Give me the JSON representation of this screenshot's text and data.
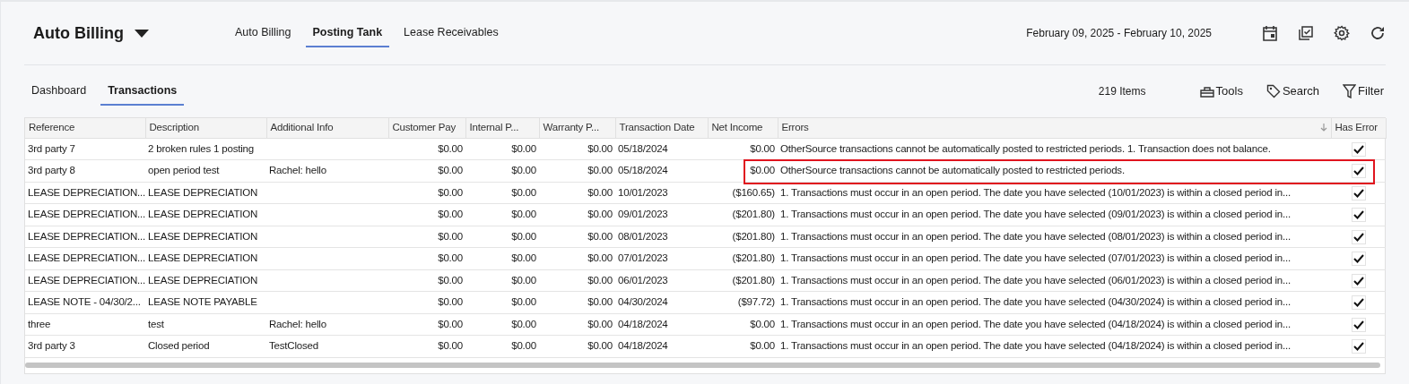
{
  "header": {
    "title": "Auto Billing",
    "nav_tabs": [
      {
        "label": "Auto Billing",
        "selected": false
      },
      {
        "label": "Posting Tank",
        "selected": true
      },
      {
        "label": "Lease Receivables",
        "selected": false
      }
    ],
    "date_range": "February 09, 2025 - February 10, 2025"
  },
  "sub_tabs": [
    {
      "label": "Dashboard",
      "selected": false
    },
    {
      "label": "Transactions",
      "selected": true
    }
  ],
  "toolbar": {
    "item_count": "219 Items",
    "actions": [
      {
        "kind": "tools",
        "label": "Tools"
      },
      {
        "kind": "search",
        "label": "Search"
      },
      {
        "kind": "filter",
        "label": "Filter"
      }
    ]
  },
  "table": {
    "columns": [
      {
        "label": "Reference",
        "sorted": false
      },
      {
        "label": "Description",
        "sorted": false
      },
      {
        "label": "Additional Info",
        "sorted": false
      },
      {
        "label": "Customer Pay",
        "sorted": false
      },
      {
        "label": "Internal P...",
        "sorted": false
      },
      {
        "label": "Warranty P...",
        "sorted": false
      },
      {
        "label": "Transaction Date",
        "sorted": false
      },
      {
        "label": "Net Income",
        "sorted": false
      },
      {
        "label": "Errors",
        "sorted": true
      },
      {
        "label": "Has Error",
        "sorted": false
      }
    ],
    "rows": [
      {
        "cells": [
          "3rd party 7",
          "2 broken rules 1 posting",
          "",
          "$0.00",
          "$0.00",
          "$0.00",
          "05/18/2024",
          "$0.00",
          "OtherSource transactions cannot be automatically posted to restricted periods. 1. Transaction does not balance."
        ],
        "has_error": true,
        "highlighted": false
      },
      {
        "cells": [
          "3rd party 8",
          "open period test",
          "Rachel: hello",
          "$0.00",
          "$0.00",
          "$0.00",
          "05/18/2024",
          "$0.00",
          "OtherSource transactions cannot be automatically posted to restricted periods."
        ],
        "has_error": true,
        "highlighted": true
      },
      {
        "cells": [
          "LEASE DEPRECIATION...",
          "LEASE DEPRECIATION",
          "",
          "$0.00",
          "$0.00",
          "$0.00",
          "10/01/2023",
          "($160.65)",
          "1. Transactions must occur in an open period. The date you have selected (10/01/2023) is within a closed period in..."
        ],
        "has_error": true,
        "highlighted": false
      },
      {
        "cells": [
          "LEASE DEPRECIATION...",
          "LEASE DEPRECIATION",
          "",
          "$0.00",
          "$0.00",
          "$0.00",
          "09/01/2023",
          "($201.80)",
          "1. Transactions must occur in an open period. The date you have selected (09/01/2023) is within a closed period in..."
        ],
        "has_error": true,
        "highlighted": false
      },
      {
        "cells": [
          "LEASE DEPRECIATION...",
          "LEASE DEPRECIATION",
          "",
          "$0.00",
          "$0.00",
          "$0.00",
          "08/01/2023",
          "($201.80)",
          "1. Transactions must occur in an open period. The date you have selected (08/01/2023) is within a closed period in..."
        ],
        "has_error": true,
        "highlighted": false
      },
      {
        "cells": [
          "LEASE DEPRECIATION...",
          "LEASE DEPRECIATION",
          "",
          "$0.00",
          "$0.00",
          "$0.00",
          "07/01/2023",
          "($201.80)",
          "1. Transactions must occur in an open period. The date you have selected (07/01/2023) is within a closed period in..."
        ],
        "has_error": true,
        "highlighted": false
      },
      {
        "cells": [
          "LEASE DEPRECIATION...",
          "LEASE DEPRECIATION",
          "",
          "$0.00",
          "$0.00",
          "$0.00",
          "06/01/2023",
          "($201.80)",
          "1. Transactions must occur in an open period. The date you have selected (06/01/2023) is within a closed period in..."
        ],
        "has_error": true,
        "highlighted": false
      },
      {
        "cells": [
          "LEASE NOTE - 04/30/2...",
          "LEASE NOTE PAYABLE",
          "",
          "$0.00",
          "$0.00",
          "$0.00",
          "04/30/2024",
          "($97.72)",
          "1. Transactions must occur in an open period. The date you have selected (04/30/2024) is within a closed period in..."
        ],
        "has_error": true,
        "highlighted": false
      },
      {
        "cells": [
          "three",
          "test",
          "Rachel: hello",
          "$0.00",
          "$0.00",
          "$0.00",
          "04/18/2024",
          "$0.00",
          "1. Transactions must occur in an open period. The date you have selected (04/18/2024) is within a closed period in..."
        ],
        "has_error": true,
        "highlighted": false
      },
      {
        "cells": [
          "3rd party 3",
          "Closed period",
          "TestClosed",
          "$0.00",
          "$0.00",
          "$0.00",
          "04/18/2024",
          "$0.00",
          "1. Transactions must occur in an open period. The date you have selected (04/18/2024) is within a closed period in..."
        ],
        "has_error": true,
        "highlighted": false
      }
    ]
  }
}
